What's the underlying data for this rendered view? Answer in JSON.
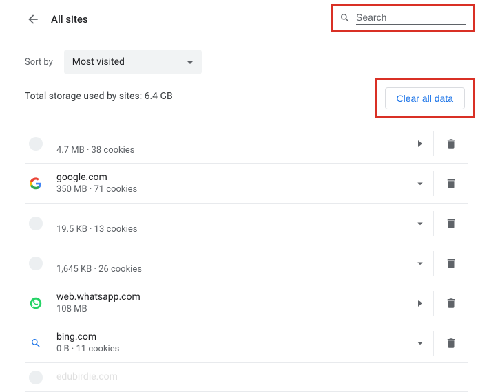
{
  "header": {
    "title": "All sites"
  },
  "search": {
    "placeholder": "Search"
  },
  "sort": {
    "label": "Sort by",
    "selected": "Most visited"
  },
  "total": {
    "text": "Total storage used by sites: 6.4 GB"
  },
  "clear": {
    "label": "Clear all data"
  },
  "sites": [
    {
      "name": "",
      "meta": "4.7 MB · 38 cookies",
      "icon": "blank",
      "exp": "right",
      "faded": true
    },
    {
      "name": "google.com",
      "meta": "350 MB · 71 cookies",
      "icon": "google",
      "exp": "down",
      "faded": false
    },
    {
      "name": "",
      "meta": "19.5 KB · 13 cookies",
      "icon": "blank",
      "exp": "down",
      "faded": true
    },
    {
      "name": "",
      "meta": "1,645 KB · 26 cookies",
      "icon": "blank",
      "exp": "down",
      "faded": true
    },
    {
      "name": "web.whatsapp.com",
      "meta": "108 MB",
      "icon": "whatsapp",
      "exp": "right",
      "faded": false
    },
    {
      "name": "bing.com",
      "meta": "0 B · 11 cookies",
      "icon": "bing",
      "exp": "down",
      "faded": false
    },
    {
      "name": "edubirdie.com",
      "meta": "",
      "icon": "blank",
      "exp": "",
      "faded": true
    }
  ]
}
